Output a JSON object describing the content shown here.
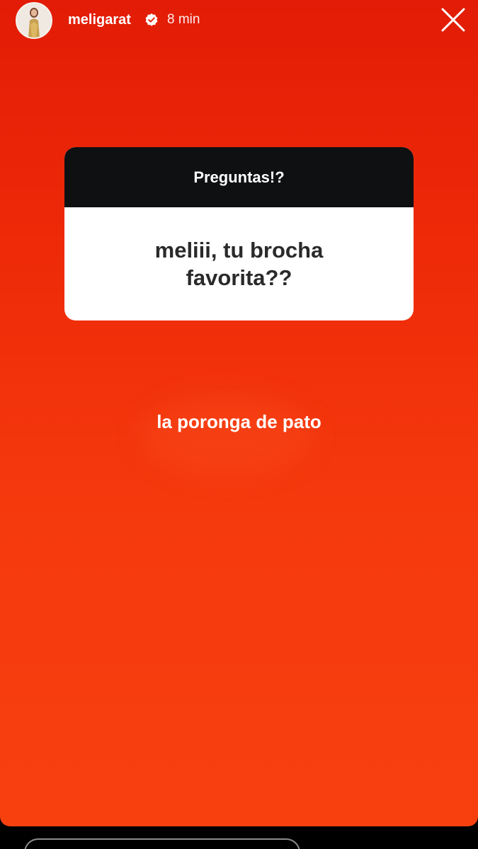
{
  "header": {
    "username": "meligarat",
    "time": "8 min",
    "icons": {
      "avatar": "profile-avatar",
      "verified": "verified-badge-icon",
      "close": "close-icon"
    }
  },
  "question_sticker": {
    "title": "Preguntas!?",
    "question": "meliii, tu brocha favorita??"
  },
  "answer": {
    "text": "la poronga de pato"
  },
  "colors": {
    "story_background_top": "#e21c06",
    "story_background_bottom": "#f8400f",
    "sticker_header": "#0f1012",
    "sticker_body": "#ffffff",
    "verified_badge": "#ffffff"
  }
}
